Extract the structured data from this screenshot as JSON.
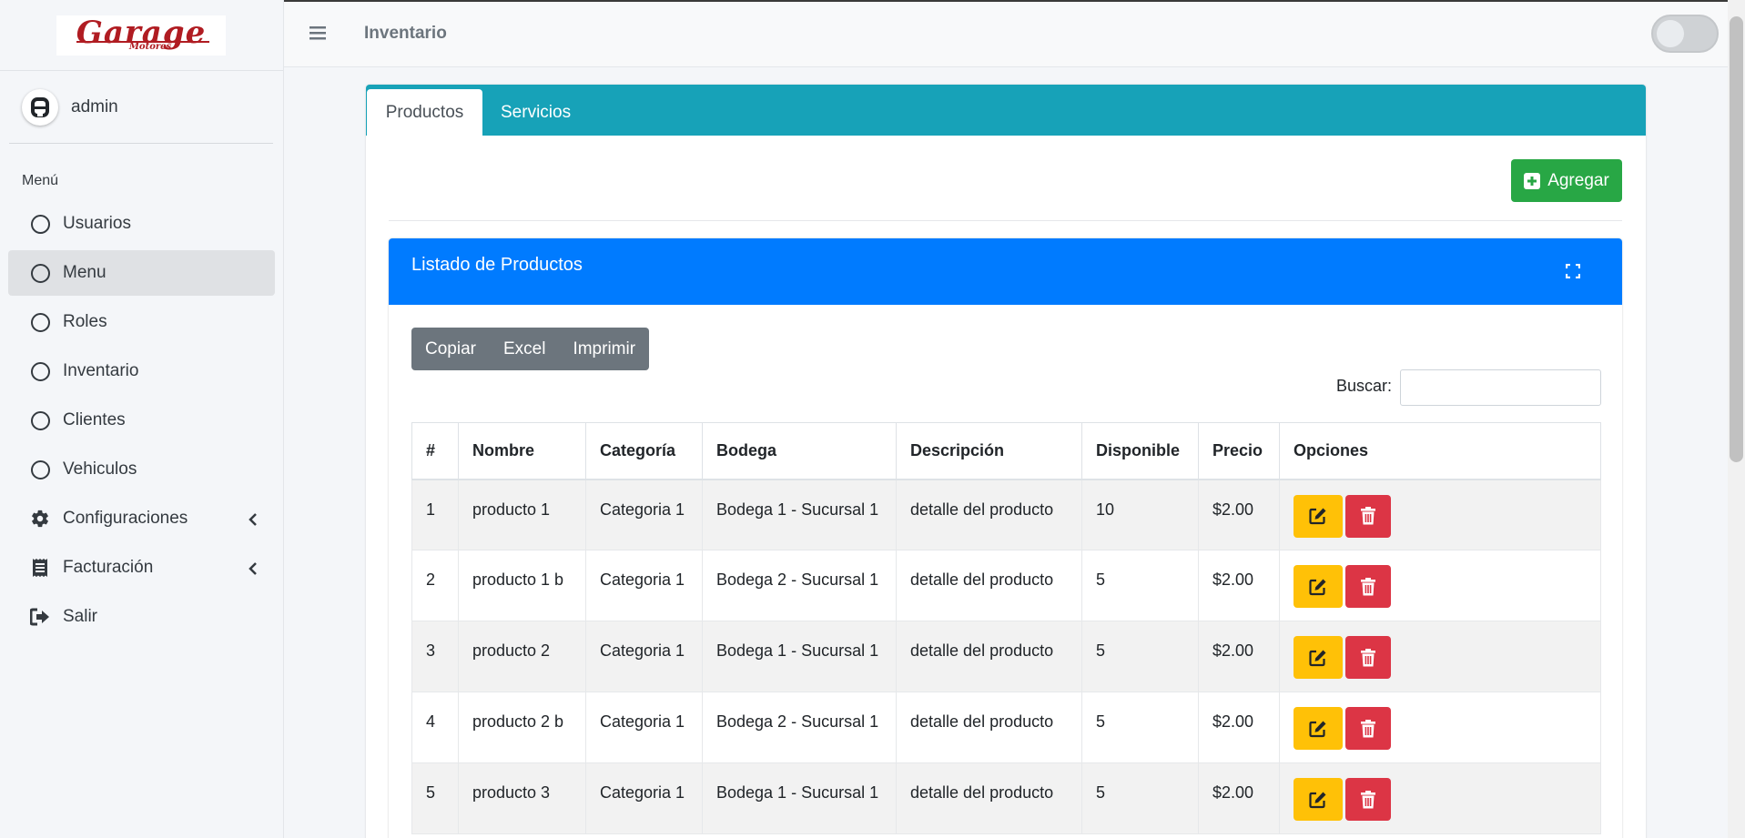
{
  "brand": {
    "logo_main": "Garage",
    "logo_sub": "Motores"
  },
  "user": {
    "name": "admin"
  },
  "sidebar": {
    "header": "Menú",
    "items": [
      {
        "label": "Usuarios",
        "icon": "circle-icon"
      },
      {
        "label": "Menu",
        "icon": "circle-icon",
        "active": true
      },
      {
        "label": "Roles",
        "icon": "circle-icon"
      },
      {
        "label": "Inventario",
        "icon": "circle-icon"
      },
      {
        "label": "Clientes",
        "icon": "circle-icon"
      },
      {
        "label": "Vehiculos",
        "icon": "circle-icon"
      },
      {
        "label": "Configuraciones",
        "icon": "gear-icon"
      },
      {
        "label": "Facturación",
        "icon": "receipt-icon"
      },
      {
        "label": "Salir",
        "icon": "sign-out-icon"
      }
    ]
  },
  "topbar": {
    "title": "Inventario"
  },
  "tabs": [
    {
      "label": "Productos"
    },
    {
      "label": "Servicios"
    }
  ],
  "actions": {
    "add_label": "Agregar"
  },
  "panel": {
    "title": "Listado de Productos",
    "buttons": [
      {
        "label": "Copiar"
      },
      {
        "label": "Excel"
      },
      {
        "label": "Imprimir"
      }
    ],
    "search_label": "Buscar:"
  },
  "table": {
    "headers": [
      "#",
      "Nombre",
      "Categoría",
      "Bodega",
      "Descripción",
      "Disponible",
      "Precio",
      "Opciones"
    ],
    "rows": [
      [
        "1",
        "producto 1",
        "Categoria 1",
        "Bodega 1 - Sucursal 1",
        "detalle del producto",
        "10",
        "$2.00"
      ],
      [
        "2",
        "producto 1 b",
        "Categoria 1",
        "Bodega 2 - Sucursal 1",
        "detalle del producto",
        "5",
        "$2.00"
      ],
      [
        "3",
        "producto 2",
        "Categoria 1",
        "Bodega 1 - Sucursal 1",
        "detalle del producto",
        "5",
        "$2.00"
      ],
      [
        "4",
        "producto 2 b",
        "Categoria 1",
        "Bodega 2 - Sucursal 1",
        "detalle del producto",
        "5",
        "$2.00"
      ],
      [
        "5",
        "producto 3",
        "Categoria 1",
        "Bodega 1 - Sucursal 1",
        "detalle del producto",
        "5",
        "$2.00"
      ]
    ]
  },
  "colors": {
    "tabs_bar": "#17a2b8",
    "panel_header": "#007bff",
    "add_button": "#28a745",
    "edit_button": "#ffc107",
    "delete_button": "#dc3545",
    "logo": "#b01c22"
  }
}
